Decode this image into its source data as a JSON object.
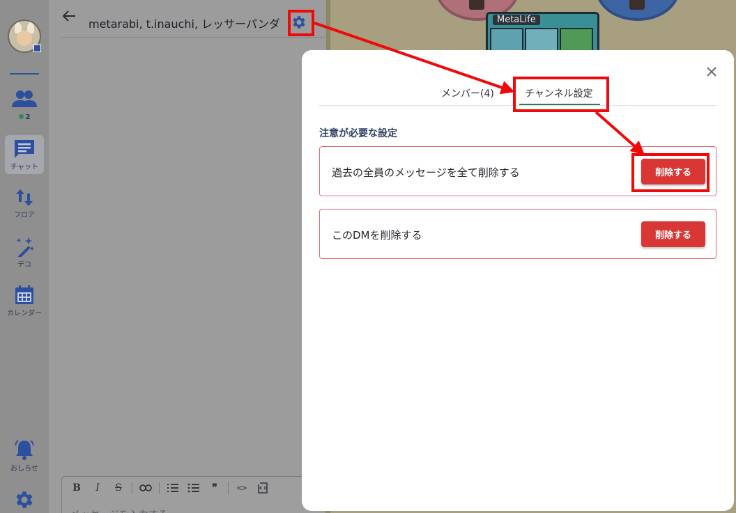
{
  "sidebar": {
    "online_count": "2",
    "items": [
      {
        "label": "チャット",
        "icon": "chat-icon"
      },
      {
        "label": "フロア",
        "icon": "floor-arrows-icon"
      },
      {
        "label": "デコ",
        "icon": "magic-wand-icon"
      },
      {
        "label": "カレンダー",
        "icon": "calendar-icon"
      },
      {
        "label": "おしらせ",
        "icon": "bell-icon"
      }
    ],
    "active_item": "チャット"
  },
  "chat": {
    "title": "metarabi, t.inauchi, レッサーパンダ",
    "composer_placeholder": "メッセージを入力する",
    "toolbar": {
      "bold": "B",
      "italic": "I",
      "strike": "S",
      "quote": "❞",
      "code": "<>"
    }
  },
  "map": {
    "sign_label": "MetaLife"
  },
  "modal": {
    "tabs": [
      {
        "label": "メンバー(4)",
        "active": false
      },
      {
        "label": "チャンネル設定",
        "active": true
      }
    ],
    "section_title": "注意が必要な設定",
    "settings": [
      {
        "label": "過去の全員のメッセージを全て削除する",
        "button": "削除する"
      },
      {
        "label": "このDMを削除する",
        "button": "削除する"
      }
    ]
  },
  "colors": {
    "accent_blue": "#2c4f9e",
    "danger": "#d93636",
    "tab_underline": "#2e7d5b",
    "annotation": "#ee0a0a"
  }
}
